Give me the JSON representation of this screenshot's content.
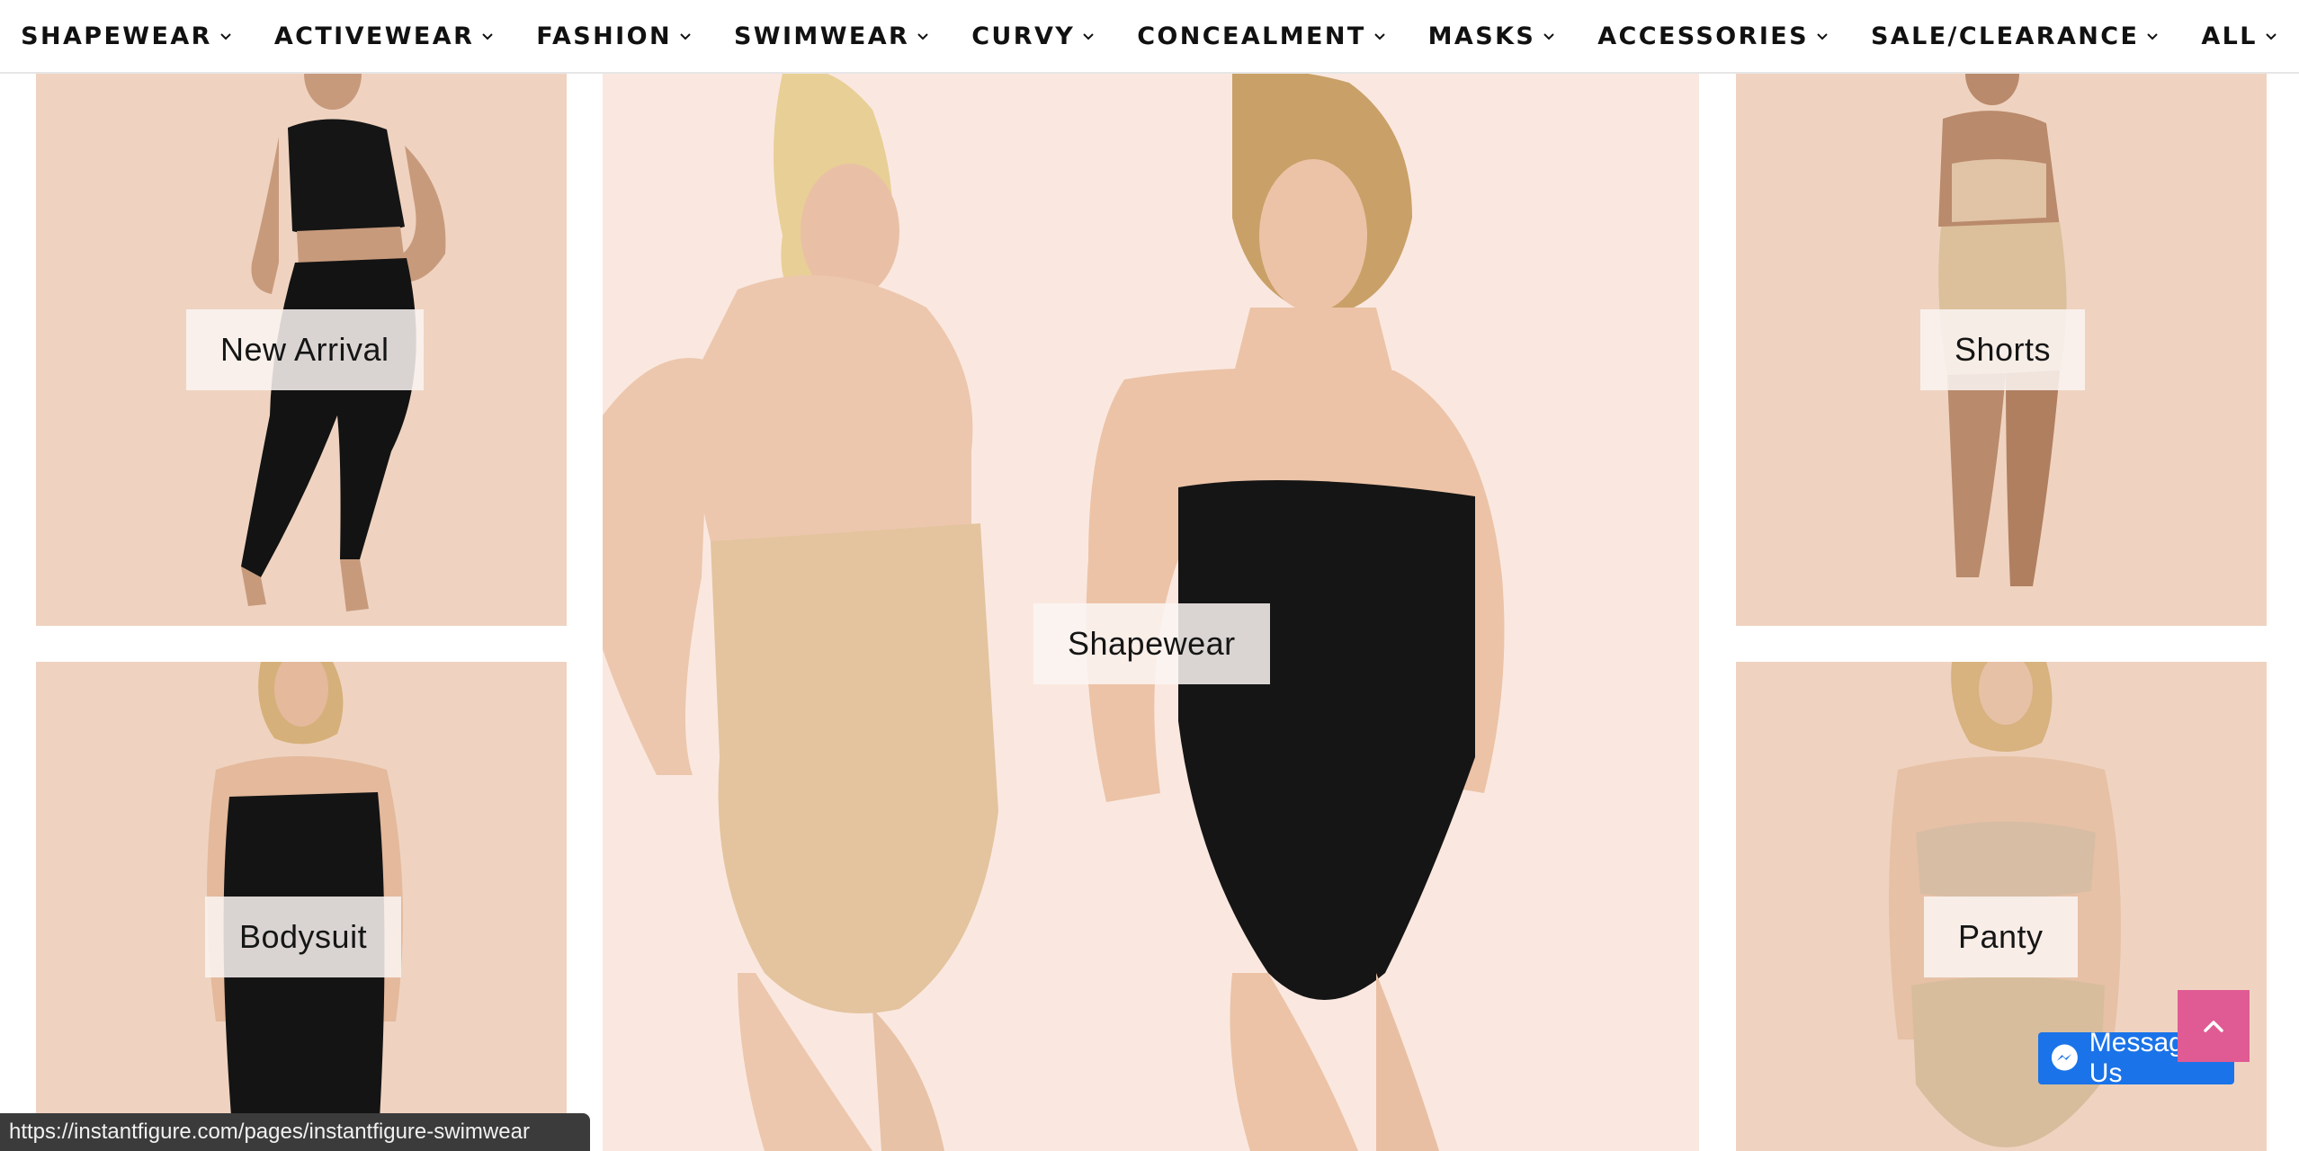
{
  "nav": {
    "items": [
      {
        "label": "SHAPEWEAR"
      },
      {
        "label": "ACTIVEWEAR"
      },
      {
        "label": "FASHION"
      },
      {
        "label": "SWIMWEAR"
      },
      {
        "label": "CURVY"
      },
      {
        "label": "CONCEALMENT"
      },
      {
        "label": "MASKS"
      },
      {
        "label": "ACCESSORIES"
      },
      {
        "label": "SALE/CLEARANCE"
      },
      {
        "label": "ALL"
      }
    ],
    "chevron_icon": "chevron-down-icon"
  },
  "tiles": {
    "new_arrival": {
      "label": "New Arrival",
      "bg": "#efd3c0"
    },
    "shapewear": {
      "label": "Shapewear",
      "bg": "#fae8e0"
    },
    "shorts": {
      "label": "Shorts",
      "bg": "#efd3c0"
    },
    "bodysuit": {
      "label": "Bodysuit",
      "bg": "#efd3c0"
    },
    "panty": {
      "label": "Panty",
      "bg": "#efd3c0"
    }
  },
  "status_bar": {
    "url": "https://instantfigure.com/pages/instantfigure-swimwear"
  },
  "messenger": {
    "label": "Message Us",
    "icon": "messenger-icon",
    "color": "#1a73e8"
  },
  "back_to_top": {
    "icon": "chevron-up-icon",
    "color": "#e05b93"
  }
}
